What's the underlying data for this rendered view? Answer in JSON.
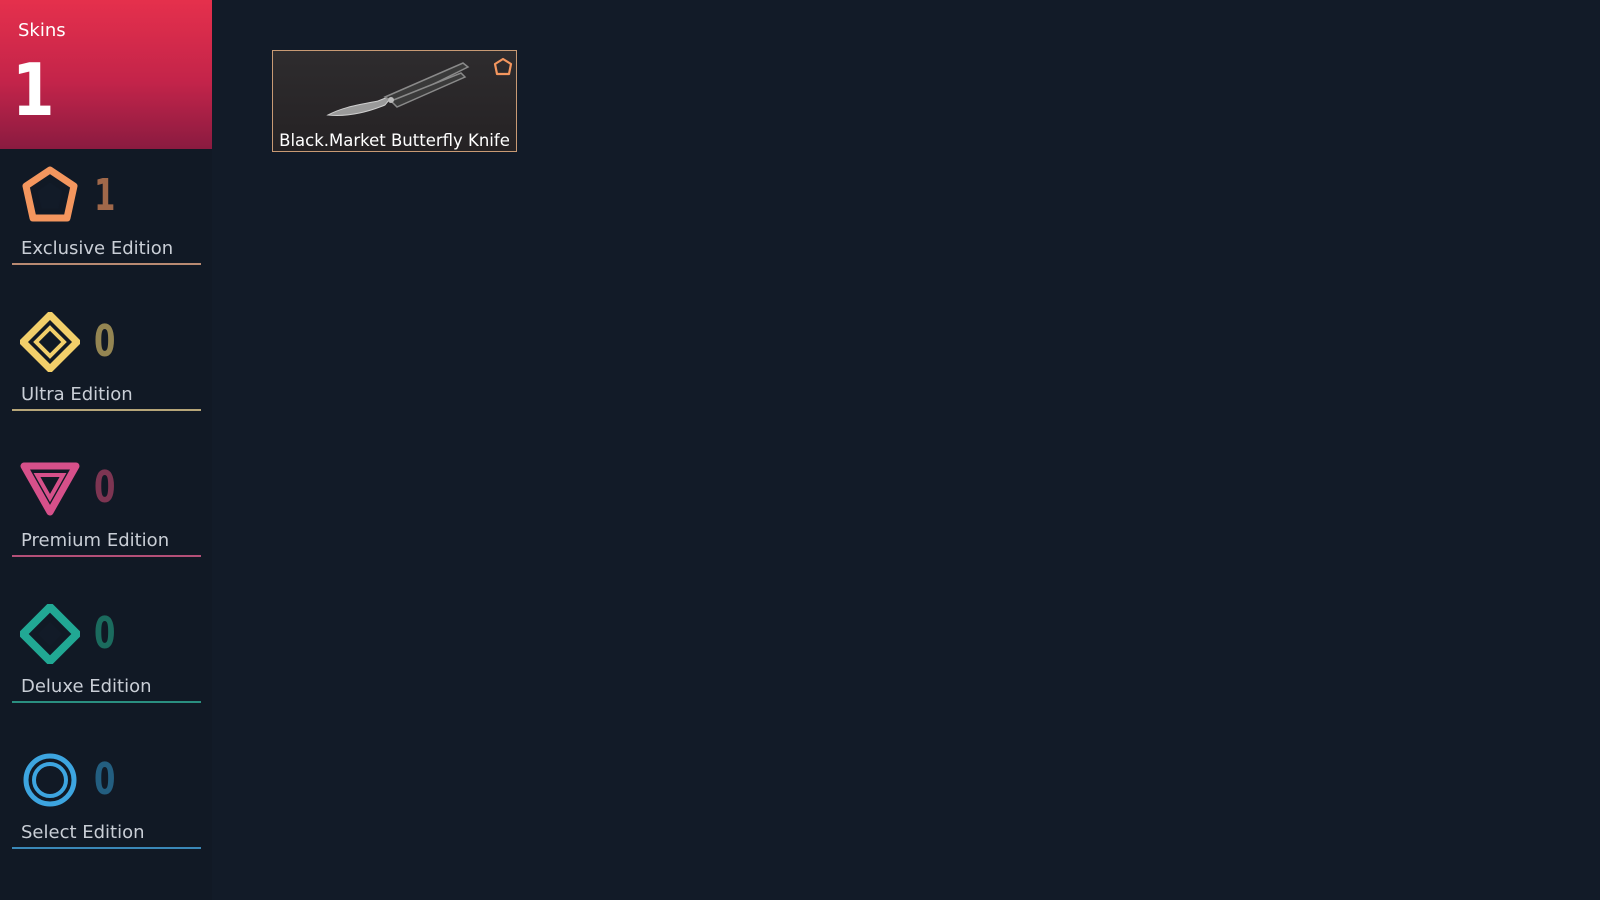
{
  "skins": {
    "title": "Skins",
    "count": "1"
  },
  "editions": [
    {
      "name": "Exclusive Edition",
      "count": "1",
      "icon": "exclusive-pentagon-icon",
      "color": "#f4965e",
      "count_color": "#a0684a",
      "line_color": "#b98a72"
    },
    {
      "name": "Ultra Edition",
      "count": "0",
      "icon": "ultra-diamond-icon",
      "color": "#f2cf6a",
      "count_color": "#948552",
      "line_color": "#b7a679"
    },
    {
      "name": "Premium Edition",
      "count": "0",
      "icon": "premium-triangle-icon",
      "color": "#d6508a",
      "count_color": "#7d3552",
      "line_color": "#b45078"
    },
    {
      "name": "Deluxe Edition",
      "count": "0",
      "icon": "deluxe-rhombus-icon",
      "color": "#21a894",
      "count_color": "#1b6b5e",
      "line_color": "#2a8f80"
    },
    {
      "name": "Select Edition",
      "count": "0",
      "icon": "select-ring-icon",
      "color": "#3da5e0",
      "count_color": "#235e80",
      "line_color": "#3a88b8"
    }
  ],
  "items": [
    {
      "name": "Black.Market Butterfly Knife",
      "edition": "Exclusive Edition",
      "icon": "butterfly-knife-icon"
    }
  ]
}
